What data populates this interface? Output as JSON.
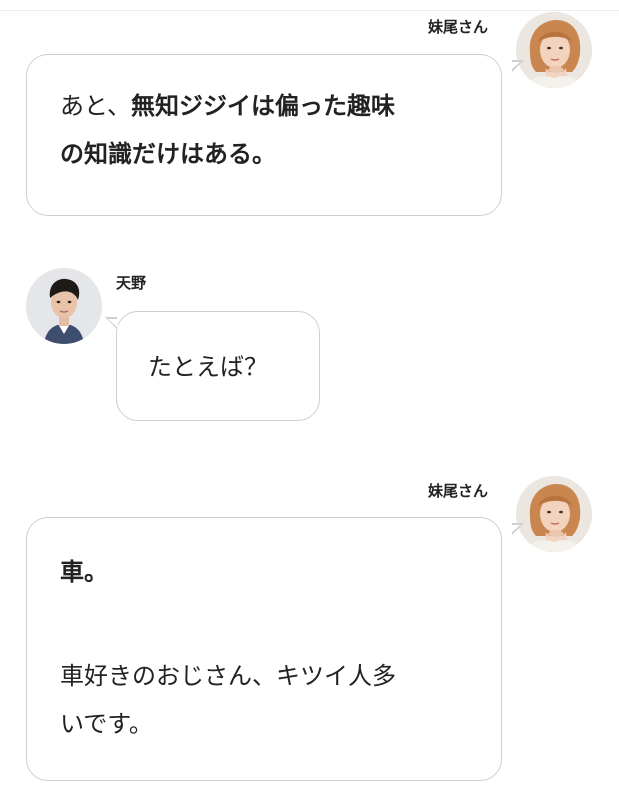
{
  "messages": [
    {
      "speaker": "妹尾さん",
      "side": "right",
      "lines": [
        [
          {
            "t": "あと、",
            "b": false
          },
          {
            "t": "無知ジジイは偏った趣味",
            "b": true
          }
        ],
        [
          {
            "t": "の知識だけはある。",
            "b": true
          }
        ]
      ]
    },
    {
      "speaker": "天野",
      "side": "left",
      "lines": [
        [
          {
            "t": "たとえば？",
            "b": false
          }
        ]
      ]
    },
    {
      "speaker": "妹尾さん",
      "side": "right",
      "lines": [
        [
          {
            "t": "車。",
            "b": true
          }
        ],
        [
          {
            "t": "",
            "b": false
          }
        ],
        [
          {
            "t": "車好きのおじさん、キツイ人多",
            "b": false
          }
        ],
        [
          {
            "t": "いです。",
            "b": false
          }
        ]
      ]
    }
  ],
  "colors": {
    "bubble_border": "#cfcfcf",
    "text": "#222222",
    "background": "#ffffff"
  }
}
